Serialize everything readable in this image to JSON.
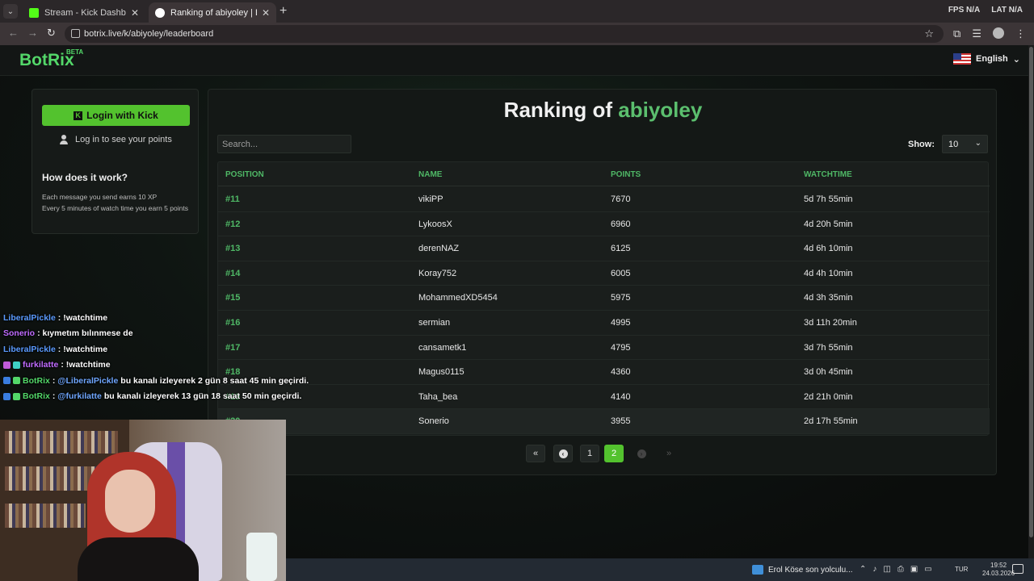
{
  "browser": {
    "tabs": [
      {
        "title": "Stream - Kick Dashboard",
        "favicon_color": "#53fc18",
        "active": false
      },
      {
        "title": "Ranking of abiyoley | BotRix — Leaderboard",
        "favicon_color": "#ffffff",
        "active": true
      }
    ],
    "url": "botrix.live/k/abiyoley/leaderboard",
    "overlay_fps": "FPS",
    "overlay_fps_value": "N/A",
    "overlay_lat": "LAT",
    "overlay_lat_value": "N/A"
  },
  "site": {
    "logo": "BotRix",
    "logo_badge": "BETA",
    "language": "English",
    "accent": "#53c22e"
  },
  "sidebar": {
    "login_button": "Login with Kick",
    "login_hint": "Log in to see your points",
    "how_title": "How does it work?",
    "how_lines": [
      "Each message you send earns 10 XP",
      "Every 5 minutes of watch time you earn 5 points"
    ]
  },
  "leaderboard": {
    "title_prefix": "Ranking of",
    "channel": "abiyoley",
    "search_placeholder": "Search...",
    "show_label": "Show:",
    "show_value": "10",
    "columns": [
      "POSITION",
      "NAME",
      "POINTS",
      "WATCHTIME"
    ],
    "rows": [
      {
        "position": "#11",
        "name": "vikiPP",
        "points": "7670",
        "watchtime": "5d 7h 55min"
      },
      {
        "position": "#12",
        "name": "LykoosX",
        "points": "6960",
        "watchtime": "4d 20h 5min"
      },
      {
        "position": "#13",
        "name": "derenNAZ",
        "points": "6125",
        "watchtime": "4d 6h 10min"
      },
      {
        "position": "#14",
        "name": "Koray752",
        "points": "6005",
        "watchtime": "4d 4h 10min"
      },
      {
        "position": "#15",
        "name": "MohammedXD5454",
        "points": "5975",
        "watchtime": "4d 3h 35min"
      },
      {
        "position": "#16",
        "name": "sermian",
        "points": "4995",
        "watchtime": "3d 11h 20min"
      },
      {
        "position": "#17",
        "name": "cansametk1",
        "points": "4795",
        "watchtime": "3d 7h 55min"
      },
      {
        "position": "#18",
        "name": "Magus0115",
        "points": "4360",
        "watchtime": "3d 0h 45min"
      },
      {
        "position": "#19",
        "name": "Taha_bea",
        "points": "4140",
        "watchtime": "2d 21h 0min"
      },
      {
        "position": "#20",
        "name": "Sonerio",
        "points": "3955",
        "watchtime": "2d 17h 55min"
      }
    ],
    "pagination": {
      "first": "«",
      "prev": "‹",
      "pages": [
        "1",
        "2"
      ],
      "current": "2",
      "next": "›",
      "last": "»"
    }
  },
  "chat": [
    {
      "user": "LiberalPickle",
      "user_color": "#5b9bff",
      "message": ": !watchtime",
      "badges": []
    },
    {
      "user": "Sonerio",
      "user_color": "#c06cff",
      "message": ": kıymetım bılınmese de",
      "badges": []
    },
    {
      "user": "LiberalPickle",
      "user_color": "#5b9bff",
      "message": ": !watchtime",
      "badges": []
    },
    {
      "user": "furkilatte",
      "user_color": "#c06cff",
      "message": ": !watchtime",
      "badges": [
        "#c05bd8",
        "#3fd0c5"
      ]
    },
    {
      "user": "BotRix",
      "user_color": "#53d769",
      "mention": "@LiberalPickle",
      "message": "bu kanalı izleyerek 2 gün 8 saat 45 min geçirdi.",
      "badges": [
        "#3a7de0",
        "#53d769"
      ]
    },
    {
      "user": "BotRix",
      "user_color": "#53d769",
      "mention": "@furkilatte",
      "message": "bu kanalı izleyerek 13 gün 18 saat 50 min geçirdi.",
      "badges": [
        "#3a7de0",
        "#53d769"
      ]
    }
  ],
  "taskbar": {
    "news": "Erol Köse son yolculu...",
    "input_lang": "TUR",
    "time": "19:52",
    "date": "24.03.2026"
  }
}
